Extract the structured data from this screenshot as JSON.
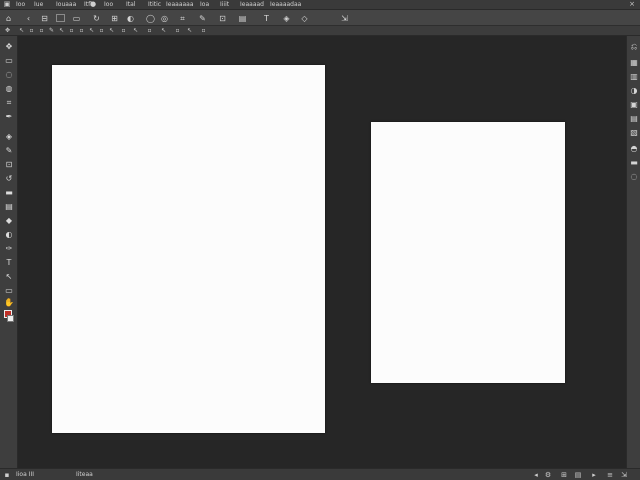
{
  "menu": {
    "items": [
      "Ioo",
      "Iue",
      "Iouaaa",
      "Itfl",
      "Ioo",
      "Ital",
      "Ititic",
      "Ieaaaaaa",
      "Ioa",
      "Iiiit",
      "Ieaaaad",
      "Ieaaaadaa"
    ]
  },
  "status": {
    "left_text": "Iioa III",
    "zoom_label": "Iiteaa"
  },
  "colors": {
    "foreground": "#c03028",
    "background": "#f0f0f0",
    "workspace": "#262626",
    "document": "#fcfcfc"
  },
  "icons": {
    "options": [
      "home-icon",
      "move-icon",
      "align-left-icon",
      "align-center-icon",
      "rotate-icon",
      "grid-icon",
      "select-icon",
      "ellipse-icon",
      "lasso-icon",
      "crop-icon",
      "brush-icon",
      "stamp-icon",
      "gradient-icon",
      "type-icon",
      "path-icon",
      "shape-icon"
    ],
    "tools": [
      "move-tool-icon",
      "marquee-tool-icon",
      "lasso-tool-icon",
      "quick-select-icon",
      "crop-tool-icon",
      "eyedropper-icon",
      "healing-brush-icon",
      "brush-tool-icon",
      "clone-stamp-icon",
      "history-brush-icon",
      "eraser-tool-icon",
      "gradient-tool-icon",
      "blur-tool-icon",
      "dodge-tool-icon",
      "pen-tool-icon",
      "type-tool-icon",
      "path-select-icon",
      "shape-tool-icon",
      "hand-tool-icon",
      "zoom-tool-icon"
    ],
    "panels": [
      "history-panel-icon",
      "color-panel-icon",
      "swatches-panel-icon",
      "adjustments-panel-icon",
      "styles-panel-icon",
      "layers-panel-icon",
      "channels-panel-icon",
      "paths-panel-icon",
      "properties-panel-icon",
      "libraries-panel-icon"
    ]
  }
}
